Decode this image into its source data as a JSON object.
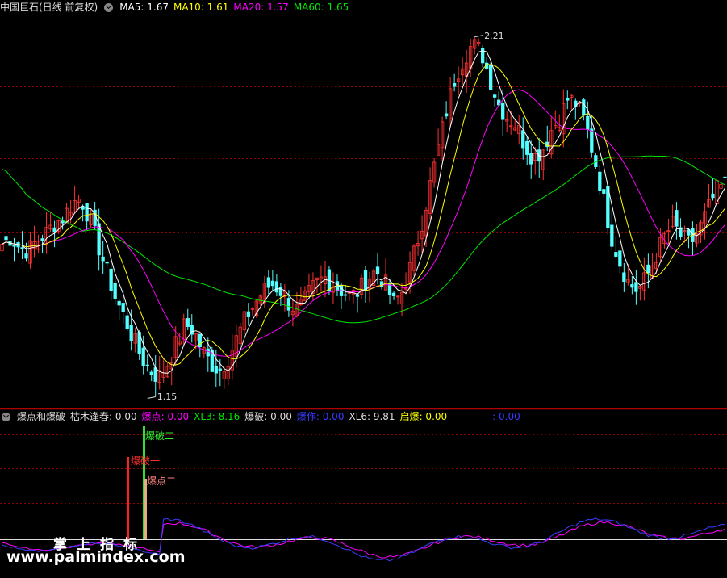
{
  "header_main": {
    "title": "中国巨石(日线 前复权)",
    "ma5": "MA5: 1.67",
    "ma10": "MA10: 1.61",
    "ma20": "MA20: 1.57",
    "ma60": "MA60: 1.65"
  },
  "header_sub": {
    "title": "爆点和爆破",
    "kumu": "枯木逢春: 0.00",
    "baodian": "爆点: 0.00",
    "xl3": "XL3: 8.16",
    "baopo": "爆破: 0.00",
    "baozuo": "爆作: 0.00",
    "xl6": "XL6: 9.81",
    "qibao": "启爆: 0.00",
    "extra": ": 0.00"
  },
  "colors": {
    "up": "#ff3232",
    "down": "#54ffff",
    "ma5": "#ffffff",
    "ma10": "#ffff00",
    "ma20": "#ff00ff",
    "ma60": "#00e600",
    "grid": "#8b0000"
  },
  "watermark": {
    "line1": "掌上指标",
    "line2": "www.palmindex.com"
  },
  "annotations": {
    "high": "2.21",
    "low": "1.15",
    "sig1": "爆破一",
    "sig2": "爆破二",
    "sig3": "爆点二"
  },
  "chart_data": {
    "type": "candlestick",
    "price_ylim": [
      1.1,
      2.26
    ],
    "high_label": 2.21,
    "low_label": 1.15,
    "close_path": [
      1.58,
      1.6,
      1.57,
      1.56,
      1.59,
      1.61,
      1.64,
      1.66,
      1.7,
      1.72,
      1.66,
      1.58,
      1.5,
      1.42,
      1.36,
      1.3,
      1.24,
      1.2,
      1.18,
      1.22,
      1.28,
      1.34,
      1.32,
      1.26,
      1.22,
      1.2,
      1.24,
      1.3,
      1.36,
      1.4,
      1.44,
      1.46,
      1.44,
      1.4,
      1.38,
      1.42,
      1.46,
      1.48,
      1.46,
      1.44,
      1.42,
      1.44,
      1.48,
      1.5,
      1.46,
      1.4,
      1.44,
      1.52,
      1.62,
      1.74,
      1.86,
      1.98,
      2.08,
      2.14,
      2.18,
      2.16,
      2.08,
      2.0,
      1.96,
      1.94,
      1.88,
      1.84,
      1.86,
      1.92,
      1.96,
      2.02,
      2.0,
      1.94,
      1.84,
      1.72,
      1.6,
      1.52,
      1.46,
      1.44,
      1.48,
      1.54,
      1.6,
      1.64,
      1.6,
      1.58,
      1.62,
      1.68,
      1.74,
      1.76
    ]
  }
}
